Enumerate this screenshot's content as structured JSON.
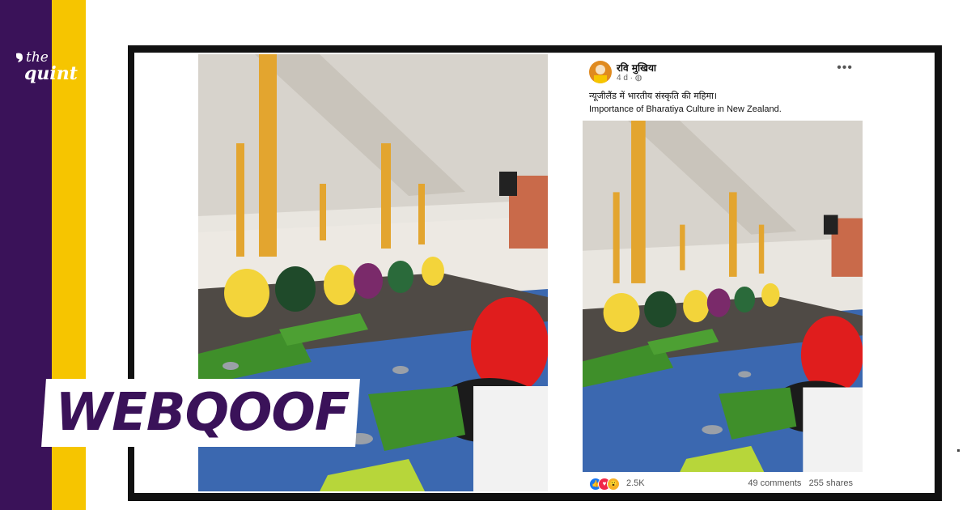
{
  "brand": {
    "the": "the",
    "quint": "quint",
    "colors": {
      "purple": "#3a1259",
      "yellow": "#f6c500"
    }
  },
  "badge": {
    "label": "WEBQOOF"
  },
  "post": {
    "author": "रवि मुखिया",
    "time": "4 d ·",
    "privacy_icon": "globe-icon",
    "more": "•••",
    "caption_hindi": "न्यूजीलैंड में भारतीय संस्कृति की महिमा।",
    "caption_english": "Importance of Bharatiya Culture in New Zealand.",
    "reactions": [
      "like-icon",
      "love-icon",
      "wow-icon"
    ],
    "reaction_count": "2.5K",
    "comments": "49 comments",
    "shares": "255 shares"
  }
}
